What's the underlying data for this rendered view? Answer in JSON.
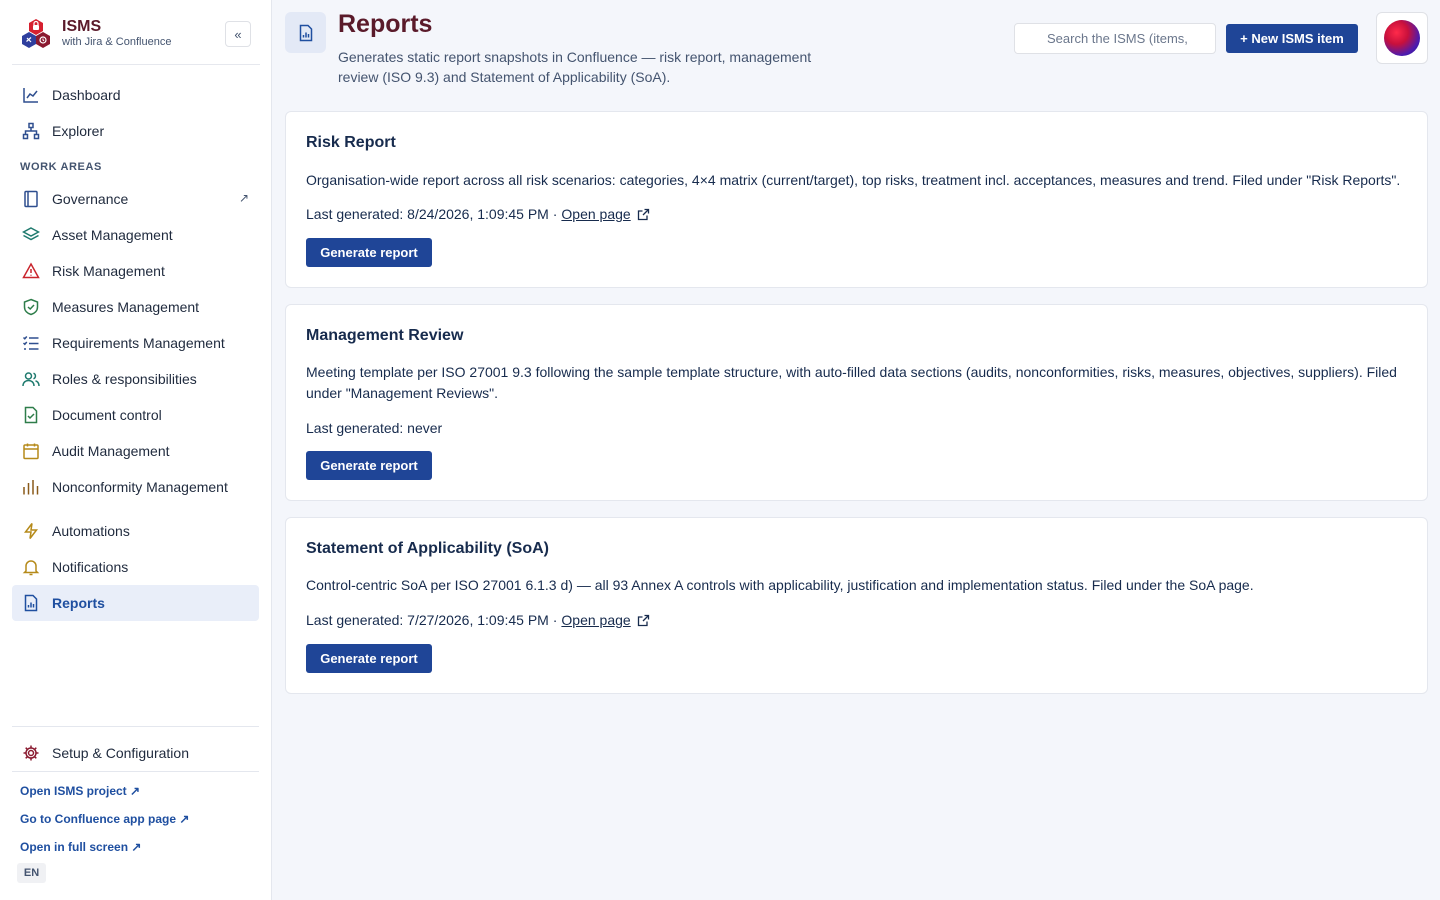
{
  "brand": {
    "title": "ISMS",
    "subtitle": "with Jira & Confluence",
    "collapse_label": "«"
  },
  "nav": {
    "top": [
      {
        "label": "Dashboard",
        "icon": "chart-line-icon"
      },
      {
        "label": "Explorer",
        "icon": "hierarchy-icon"
      }
    ],
    "section_label": "WORK AREAS",
    "work_areas": [
      {
        "label": "Governance",
        "icon": "book-icon",
        "external": "↗"
      },
      {
        "label": "Asset Management",
        "icon": "layers-icon"
      },
      {
        "label": "Risk Management",
        "icon": "warning-icon"
      },
      {
        "label": "Measures Management",
        "icon": "shield-check-icon"
      },
      {
        "label": "Requirements Management",
        "icon": "checklist-icon"
      },
      {
        "label": "Roles & responsibilities",
        "icon": "users-icon"
      },
      {
        "label": "Document control",
        "icon": "document-check-icon"
      },
      {
        "label": "Audit Management",
        "icon": "calendar-icon"
      },
      {
        "label": "Nonconformity Management",
        "icon": "bar-chart-icon"
      }
    ],
    "bottom": [
      {
        "label": "Automations",
        "icon": "lightning-icon"
      },
      {
        "label": "Notifications",
        "icon": "bell-icon"
      },
      {
        "label": "Reports",
        "icon": "report-icon",
        "active": true
      }
    ],
    "setup": {
      "label": "Setup & Configuration",
      "icon": "gear-icon"
    },
    "footer_links": [
      "Open ISMS project ↗",
      "Go to Confluence app page ↗",
      "Open in full screen ↗"
    ],
    "language": "EN"
  },
  "header": {
    "title": "Reports",
    "description": "Generates static report snapshots in Confluence — risk report, management review (ISO 9.3) and Statement of Applicability (SoA).",
    "search_placeholder": "Search the ISMS (items,",
    "new_button": "+ New ISMS item"
  },
  "cards": [
    {
      "title": "Risk Report",
      "description": "Organisation-wide report across all risk scenarios: categories, 4×4 matrix (current/target), top risks, treatment incl. acceptances, measures and trend. Filed under \"Risk Reports\".",
      "last_generated": "Last generated: 8/24/2026, 1:09:45 PM ·",
      "link": "Open page",
      "button": "Generate report"
    },
    {
      "title": "Management Review",
      "description": "Meeting template per ISO 27001 9.3 following the sample template structure, with auto-filled data sections (audits, nonconformities, risks, measures, objectives, suppliers). Filed under \"Management Reviews\".",
      "last_generated": "Last generated: never",
      "link": "",
      "button": "Generate report"
    },
    {
      "title": "Statement of Applicability (SoA)",
      "description": "Control-centric SoA per ISO 27001 6.1.3 d) — all 93 Annex A controls with applicability, justification and implementation status. Filed under the SoA page.",
      "last_generated": "Last generated: 7/27/2026, 1:09:45 PM ·",
      "link": "Open page",
      "button": "Generate report"
    }
  ],
  "colors": {
    "brand": "#5a1a2a",
    "primary": "#1f4597",
    "active_bg": "#e9eef9",
    "link": "#1f4fa0"
  }
}
